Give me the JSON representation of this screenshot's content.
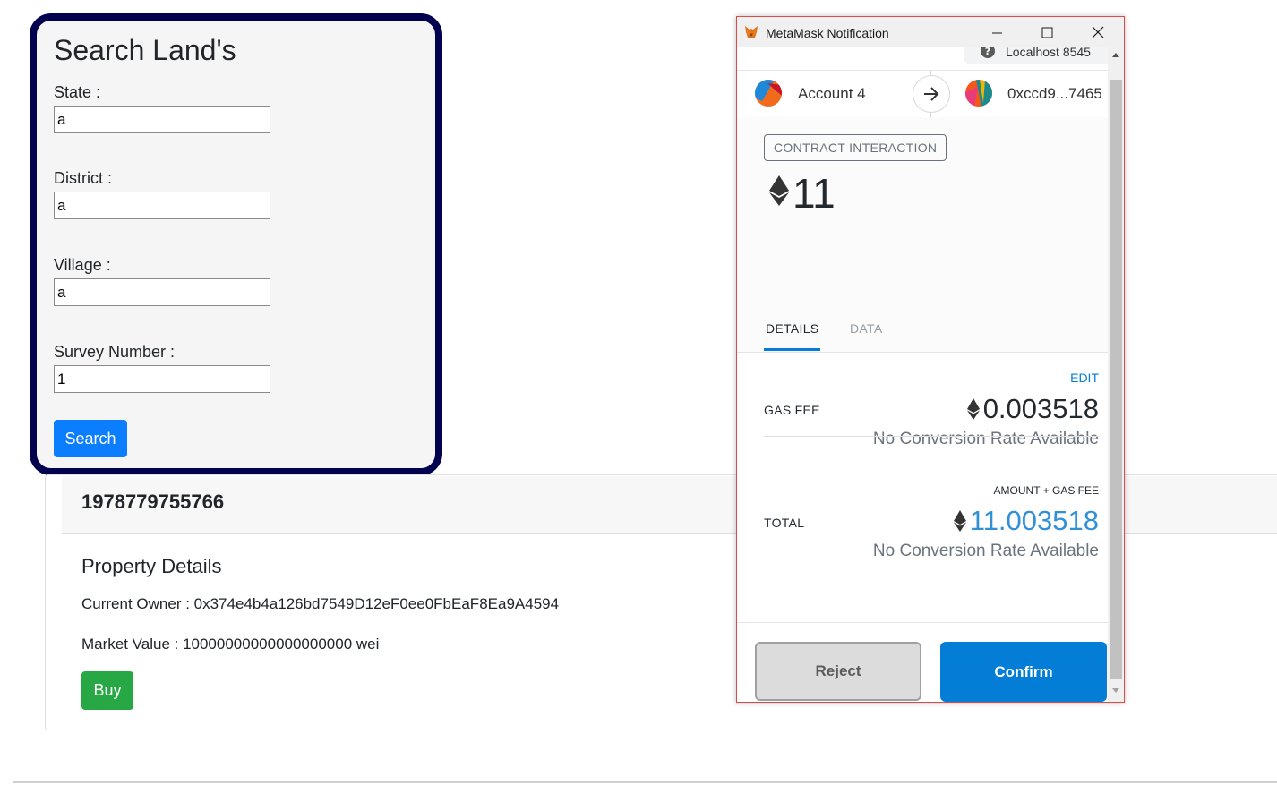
{
  "search": {
    "title": "Search Land's",
    "state_label": "State :",
    "state_value": "a",
    "district_label": "District :",
    "district_value": "a",
    "village_label": "Village :",
    "village_value": "a",
    "survey_label": "Survey Number :",
    "survey_value": "1",
    "button_label": "Search",
    "button_color": "#0b7dff",
    "border_color": "#03024f"
  },
  "result": {
    "property_id": "1978779755766",
    "section_title": "Property Details",
    "owner_line": "Current Owner : 0x374e4b4a126bd7549D12eF0ee0FbEaF8Ea9A4594",
    "market_value_line": "Market Value : 10000000000000000000 wei",
    "buy_label": "Buy",
    "buy_color": "#27a844"
  },
  "metamask": {
    "window_title": "MetaMask Notification",
    "network": "Localhost 8545",
    "from_account": "Account 4",
    "to_account": "0xccd9...7465",
    "badge": "CONTRACT INTERACTION",
    "amount": "11",
    "tabs": [
      {
        "label": "DETAILS",
        "active": true
      },
      {
        "label": "DATA",
        "active": false
      }
    ],
    "edit_label": "EDIT",
    "gas_fee_label": "GAS FEE",
    "gas_fee_value": "0.003518",
    "gas_conversion": "No Conversion Rate Available",
    "total_caption": "AMOUNT + GAS FEE",
    "total_label": "TOTAL",
    "total_value": "11.003518",
    "total_conversion": "No Conversion Rate Available",
    "reject_label": "Reject",
    "confirm_label": "Confirm",
    "accent_color": "#037dd6"
  },
  "icons": [
    "fox-icon",
    "minimize-icon",
    "maximize-icon",
    "close-icon",
    "help-icon",
    "account-avatar-icon",
    "arrow-right-icon",
    "ethereum-icon",
    "scroll-up-icon",
    "scroll-down-icon"
  ]
}
